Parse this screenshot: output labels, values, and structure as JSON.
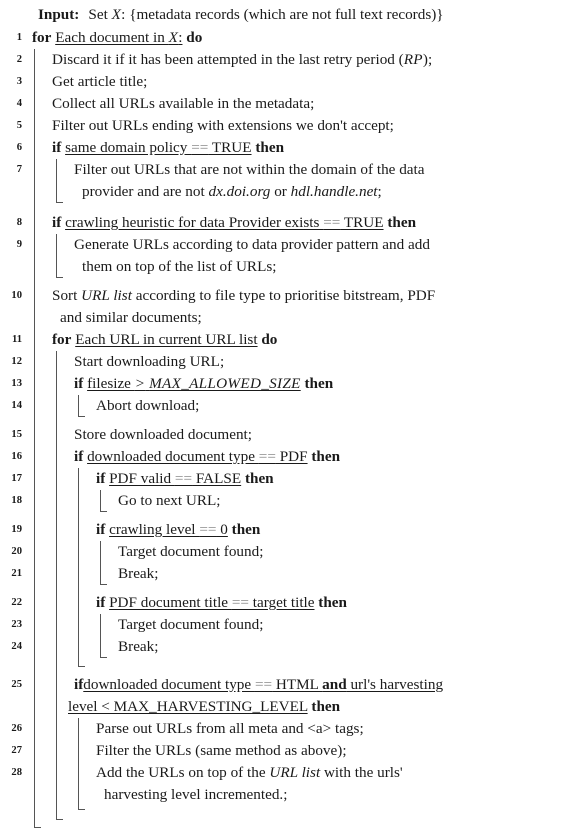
{
  "algorithm": {
    "input": {
      "label": "Input:",
      "text": "Set X: {metadata records (which are not full text records)}"
    },
    "lines": [
      {
        "num": "1",
        "depth": 0,
        "kind": "for",
        "keyword": "for",
        "condition": "Each document in X:",
        "end_keyword": "do",
        "text": "for Each document in X: do"
      },
      {
        "num": "2",
        "depth": 1,
        "kind": "stmt",
        "text": "Discard it if it has been attempted in the last retry period (RP);"
      },
      {
        "num": "3",
        "depth": 1,
        "kind": "stmt",
        "text": "Get article title;"
      },
      {
        "num": "4",
        "depth": 1,
        "kind": "stmt",
        "text": "Collect all URLs available in the metadata;"
      },
      {
        "num": "5",
        "depth": 1,
        "kind": "stmt",
        "text": "Filter out URLs ending with extensions we don't accept;"
      },
      {
        "num": "6",
        "depth": 1,
        "kind": "if",
        "keyword": "if",
        "condition": "same domain policy == TRUE",
        "end_keyword": "then",
        "text": "if same domain policy == TRUE then"
      },
      {
        "num": "7",
        "depth": 2,
        "kind": "stmt",
        "text": "Filter out URLs that are not within the domain of the data provider and are not dx.doi.org or hdl.handle.net;",
        "line1": "Filter out URLs that are not within the domain of the data",
        "line2": "provider and are not dx.doi.org or hdl.handle.net;"
      },
      {
        "num": "8",
        "depth": 1,
        "kind": "if",
        "keyword": "if",
        "condition": "crawling heuristic for data Provider exists == TRUE",
        "end_keyword": "then",
        "text": "if crawling heuristic for data Provider exists == TRUE then"
      },
      {
        "num": "9",
        "depth": 2,
        "kind": "stmt",
        "text": "Generate URLs according to data provider pattern and add them on top of the list of URLs;",
        "line1": "Generate URLs according to data provider pattern and add",
        "line2": "them on top of the list of URLs;"
      },
      {
        "num": "10",
        "depth": 1,
        "kind": "stmt",
        "text": "Sort URL list according to file type to prioritise bitstream, PDF and similar documents;",
        "line1": "Sort URL list according to file type to prioritise bitstream, PDF",
        "line2": "and similar documents;"
      },
      {
        "num": "11",
        "depth": 1,
        "kind": "for",
        "keyword": "for",
        "condition": "Each URL in current URL list",
        "end_keyword": "do",
        "text": "for Each URL in current URL list do"
      },
      {
        "num": "12",
        "depth": 2,
        "kind": "stmt",
        "text": "Start downloading URL;"
      },
      {
        "num": "13",
        "depth": 2,
        "kind": "if",
        "keyword": "if",
        "condition": "filesize > MAX_ALLOWED_SIZE",
        "end_keyword": "then",
        "text": "if filesize > MAX_ALLOWED_SIZE then"
      },
      {
        "num": "14",
        "depth": 3,
        "kind": "stmt",
        "text": "Abort download;"
      },
      {
        "num": "15",
        "depth": 2,
        "kind": "stmt",
        "text": "Store downloaded document;"
      },
      {
        "num": "16",
        "depth": 2,
        "kind": "if",
        "keyword": "if",
        "condition": "downloaded document type == PDF",
        "end_keyword": "then",
        "text": "if downloaded document type == PDF then"
      },
      {
        "num": "17",
        "depth": 3,
        "kind": "if",
        "keyword": "if",
        "condition": "PDF valid == FALSE",
        "end_keyword": "then",
        "text": "if PDF valid == FALSE then"
      },
      {
        "num": "18",
        "depth": 4,
        "kind": "stmt",
        "text": "Go to next URL;"
      },
      {
        "num": "19",
        "depth": 3,
        "kind": "if",
        "keyword": "if",
        "condition": "crawling level == 0",
        "end_keyword": "then",
        "text": "if crawling level == 0 then"
      },
      {
        "num": "20",
        "depth": 4,
        "kind": "stmt",
        "text": "Target document found;"
      },
      {
        "num": "21",
        "depth": 4,
        "kind": "stmt",
        "text": "Break;"
      },
      {
        "num": "22",
        "depth": 3,
        "kind": "if",
        "keyword": "if",
        "condition": "PDF document title == target title",
        "end_keyword": "then",
        "text": "if PDF document title == target title then"
      },
      {
        "num": "23",
        "depth": 4,
        "kind": "stmt",
        "text": "Target document found;"
      },
      {
        "num": "24",
        "depth": 4,
        "kind": "stmt",
        "text": "Break;"
      },
      {
        "num": "25",
        "depth": 2,
        "kind": "if",
        "keyword": "if",
        "condition": "downloaded document type == HTML and url's harvesting level < MAX_HARVESTING_LEVEL",
        "end_keyword": "then",
        "text": "if downloaded document type == HTML and url's harvesting level < MAX_HARVESTING_LEVEL then",
        "line1": "if downloaded document type == HTML and url's harvesting",
        "line2": "level < MAX_HARVESTING_LEVEL then"
      },
      {
        "num": "26",
        "depth": 3,
        "kind": "stmt",
        "text": "Parse out URLs from all meta and <a> tags;"
      },
      {
        "num": "27",
        "depth": 3,
        "kind": "stmt",
        "text": "Filter the URLs (same method as above);"
      },
      {
        "num": "28",
        "depth": 3,
        "kind": "stmt",
        "text": "Add the URLs on top of the URL list with the urls' harvesting level incremented.;",
        "line1": "Add the URLs on top of the URL list with the urls'",
        "line2": "harvesting level incremented.;"
      }
    ],
    "fragments": {
      "input_set": "Set",
      "input_x": "X",
      "input_rest": ": {metadata records (which are not full text records)}",
      "for": "for",
      "if": "if",
      "do": "do",
      "then": "then",
      "and": "and",
      "eq": "==",
      "gt": ">",
      "lt": "<",
      "l1_cond_a": "Each document in ",
      "l1_cond_x": "X",
      "l1_cond_b": ":",
      "l2_a": "Discard it if it has been attempted in the last retry period (",
      "l2_rp": "RP",
      "l2_b": ");",
      "l3": "Get article title;",
      "l4": "Collect all URLs available in the metadata;",
      "l5": "Filter out URLs ending with extensions we don't accept;",
      "l6_cond_a": "same domain policy ",
      "l6_cond_b": " TRUE",
      "l7_a": "Filter out URLs that are not within the domain of the data",
      "l7_b1": "provider and are not ",
      "l7_doi": "dx.doi.org",
      "l7_b2": " or ",
      "l7_hdl": "hdl.handle.net",
      "l7_b3": ";",
      "l8_cond_a": "crawling heuristic for data Provider exists ",
      "l8_cond_b": " TRUE",
      "l9_a": "Generate URLs according to data provider pattern and add",
      "l9_b": "them on top of the list of URLs;",
      "l10_a": "Sort ",
      "l10_it": "URL list",
      "l10_b": " according to file type to prioritise bitstream, PDF",
      "l10_c": "and similar documents;",
      "l11_cond": "Each URL in current URL list",
      "l12": "Start downloading URL;",
      "l13_cond_a": "filesize ",
      "l13_max": "MAX_ALLOWED_SIZE",
      "l14": "Abort download;",
      "l15": "Store downloaded document;",
      "l16_cond_a": "downloaded document type ",
      "l16_cond_b": " PDF",
      "l17_cond_a": "PDF valid ",
      "l17_cond_b": " FALSE",
      "l18": "Go to next URL;",
      "l19_cond_a": "crawling level ",
      "l19_cond_b": " 0",
      "l20": "Target document found;",
      "l21": "Break;",
      "l22_cond_a": "PDF document title ",
      "l22_cond_b": " target title",
      "l23": "Target document found;",
      "l24": "Break;",
      "l25_a": "downloaded document type ",
      "l25_b": " HTML ",
      "l25_c": " url's harvesting",
      "l25_d": "level < MAX_HARVESTING_LEVEL",
      "l26": "Parse out URLs from all meta and <a> tags;",
      "l27": "Filter the URLs (same method as above);",
      "l28_a": "Add the URLs on top of the ",
      "l28_it": "URL list",
      "l28_b": " with the urls'",
      "l28_c": "harvesting level incremented.;"
    }
  }
}
